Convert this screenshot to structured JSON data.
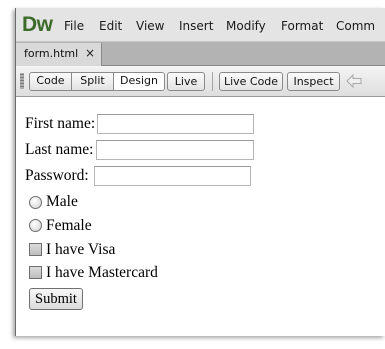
{
  "app": {
    "logo": "Dw",
    "menu": [
      "File",
      "Edit",
      "View",
      "Insert",
      "Modify",
      "Format",
      "Comm"
    ]
  },
  "tabs": [
    {
      "label": "form.html",
      "close": "×"
    }
  ],
  "toolbar": {
    "view_buttons": [
      "Code",
      "Split",
      "Design",
      "Live"
    ],
    "active_view": "Design",
    "live_code_label": "Live Code",
    "inspect_label": "Inspect",
    "back_icon": "arrow-left-icon"
  },
  "form": {
    "first_name_label": "First name:",
    "first_name_value": "",
    "last_name_label": "Last name:",
    "last_name_value": "",
    "password_label": "Password:",
    "password_value": "",
    "gender_options": [
      "Male",
      "Female"
    ],
    "card_options": [
      "I have Visa",
      "I have Mastercard"
    ],
    "submit_label": "Submit"
  },
  "colors": {
    "logo": "#3d6b2a",
    "menubar": "#e4e4e4",
    "tabstrip": "#b3b3b3"
  }
}
